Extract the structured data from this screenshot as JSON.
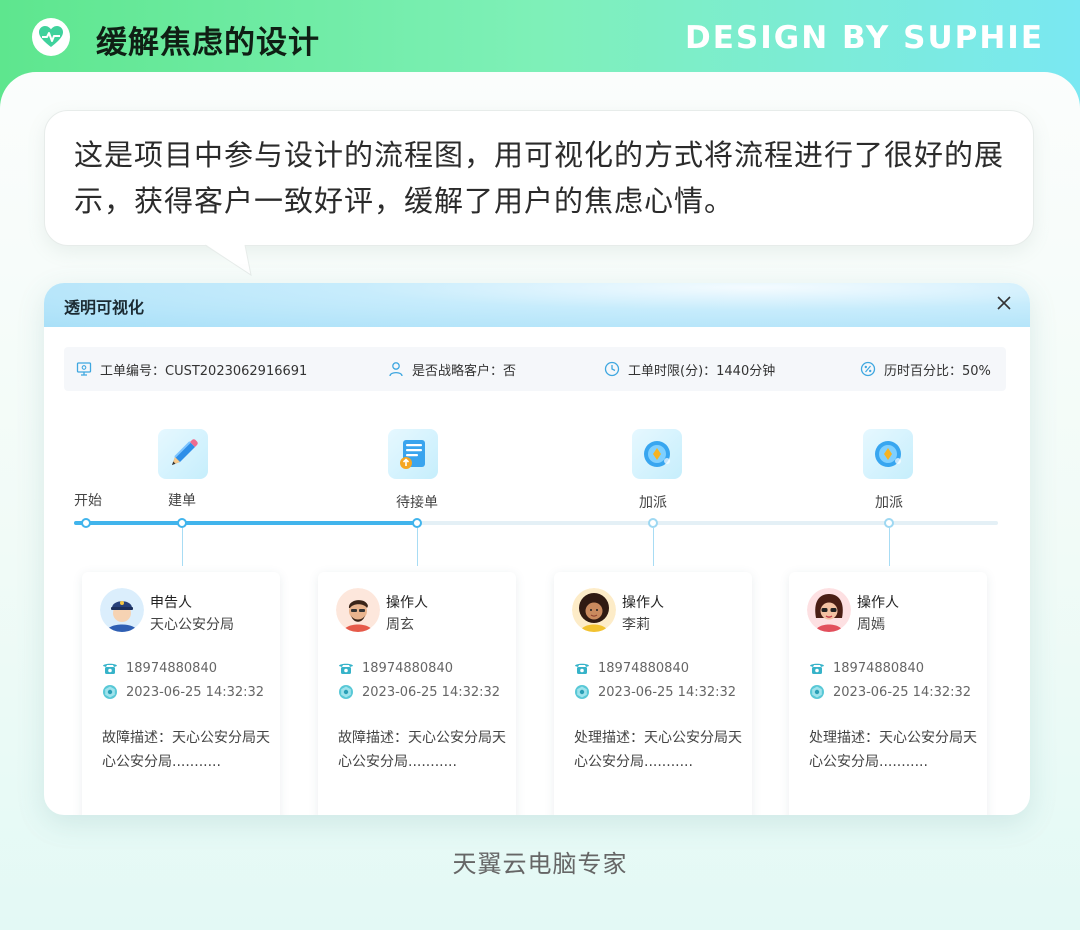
{
  "header": {
    "title": "缓解焦虑的设计",
    "brand": "DESIGN BY SUPHIE",
    "logo_icon": "heart-pulse-icon"
  },
  "intro": {
    "text": "这是项目中参与设计的流程图，用可视化的方式将流程进行了很好的展示，获得客户一致好评，缓解了用户的焦虑心情。"
  },
  "window": {
    "title": "透明可视化",
    "close_icon": "close-icon",
    "info": [
      {
        "icon": "monitor-icon",
        "text": "工单编号：CUST2023062916691"
      },
      {
        "icon": "user-icon",
        "text": "是否战略客户：否"
      },
      {
        "icon": "clock-icon",
        "text": "工单时限(分)：1440分钟"
      },
      {
        "icon": "percent-icon",
        "text": "历时百分比：50%"
      }
    ],
    "start_label": "开始",
    "progress_percent": 37,
    "steps": [
      {
        "label": "建单",
        "icon": "pencil-icon",
        "role": "申告人",
        "person": "天心公安分局",
        "avatar": "police-avatar",
        "phone": "18974880840",
        "time": "2023-06-25 14:32:32",
        "desc": "故障描述：天心公安分局天心公安分局..........."
      },
      {
        "label": "待接单",
        "icon": "document-icon",
        "role": "操作人",
        "person": "周玄",
        "avatar": "man-avatar",
        "phone": "18974880840",
        "time": "2023-06-25 14:32:32",
        "desc": "故障描述：天心公安分局天心公安分局..........."
      },
      {
        "label": "加派",
        "icon": "dispatch-icon",
        "role": "操作人",
        "person": "李莉",
        "avatar": "woman-curly-avatar",
        "phone": "18974880840",
        "time": "2023-06-25 14:32:32",
        "desc": "处理描述：天心公安分局天心公安分局..........."
      },
      {
        "label": "加派",
        "icon": "dispatch-icon",
        "role": "操作人",
        "person": "周嫣",
        "avatar": "woman-sunglasses-avatar",
        "phone": "18974880840",
        "time": "2023-06-25 14:32:32",
        "desc": "处理描述：天心公安分局天心公安分局..........."
      }
    ]
  },
  "footer": {
    "text": "天翼云电脑专家"
  },
  "colors": {
    "accent": "#41b4ec",
    "header_start": "#5ee68e",
    "header_end": "#7ae8f2"
  }
}
